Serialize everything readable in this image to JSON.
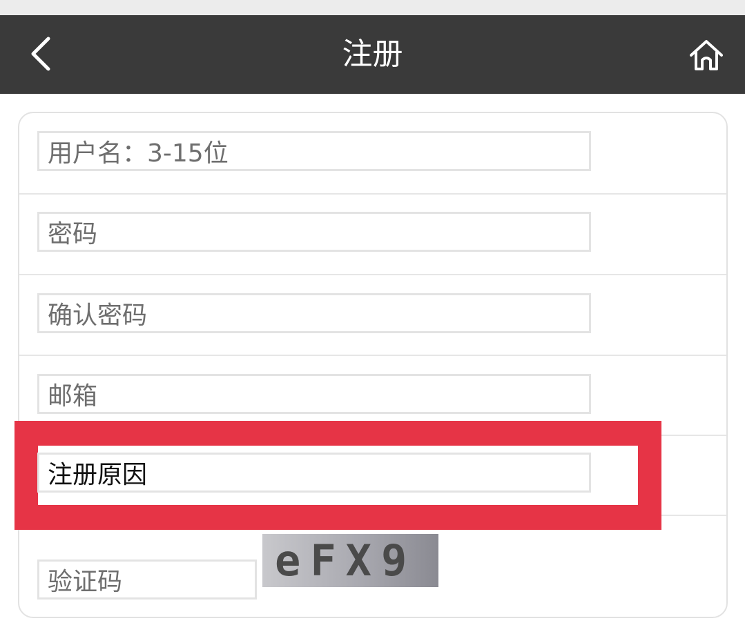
{
  "header": {
    "title": "注册",
    "back_icon": "chevron-left-icon",
    "home_icon": "home-icon",
    "background": "#3a3a3a"
  },
  "form": {
    "username": {
      "placeholder": "用户名：3-15位",
      "value": ""
    },
    "password": {
      "placeholder": "密码",
      "value": ""
    },
    "confirm_password": {
      "placeholder": "确认密码",
      "value": ""
    },
    "email": {
      "placeholder": "邮箱",
      "value": ""
    },
    "reason": {
      "placeholder": "",
      "value": "注册原因"
    },
    "captcha_input": {
      "placeholder": "验证码",
      "value": ""
    },
    "captcha_image_text": "eFX9"
  },
  "colors": {
    "highlight": "#e63446",
    "field_border": "#e3e3e3",
    "placeholder_text": "#6e6e6e"
  }
}
